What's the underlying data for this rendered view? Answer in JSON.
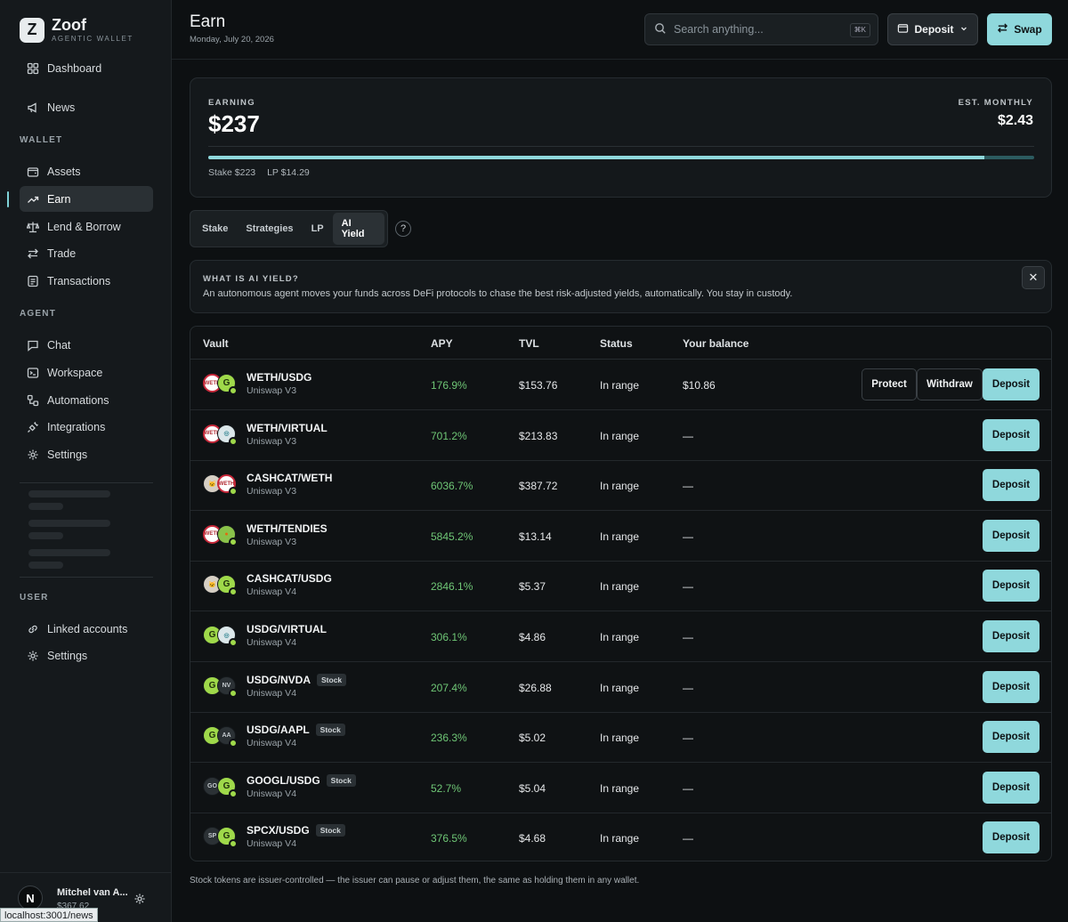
{
  "brand": {
    "name": "Zoof",
    "subtitle": "AGENTIC WALLET",
    "logo_letter": "Z"
  },
  "sidebar": {
    "top_items": [
      {
        "label": "Dashboard",
        "icon": "grid-icon"
      },
      {
        "label": "News",
        "icon": "megaphone-icon"
      }
    ],
    "wallet_label": "WALLET",
    "wallet_items": [
      {
        "label": "Assets",
        "icon": "wallet-icon"
      },
      {
        "label": "Earn",
        "icon": "trending-up-icon",
        "active": true
      },
      {
        "label": "Lend & Borrow",
        "icon": "scale-icon"
      },
      {
        "label": "Trade",
        "icon": "arrows-swap-icon"
      },
      {
        "label": "Transactions",
        "icon": "receipt-icon"
      }
    ],
    "agent_label": "AGENT",
    "agent_items": [
      {
        "label": "Chat",
        "icon": "chat-icon"
      },
      {
        "label": "Workspace",
        "icon": "terminal-icon"
      },
      {
        "label": "Automations",
        "icon": "workflow-icon"
      },
      {
        "label": "Integrations",
        "icon": "plug-icon"
      },
      {
        "label": "Settings",
        "icon": "gear-icon"
      }
    ],
    "user_label": "USER",
    "user_items": [
      {
        "label": "Linked accounts",
        "icon": "link-icon"
      },
      {
        "label": "Settings",
        "icon": "gear-icon"
      }
    ]
  },
  "user": {
    "initial": "N",
    "name": "Mitchel van A...",
    "balance": "$367.62"
  },
  "status_url": "localhost:3001/news",
  "header": {
    "title": "Earn",
    "date": "Monday, July 20, 2026",
    "search_placeholder": "Search anything...",
    "search_shortcut": "⌘K",
    "deposit_label": "Deposit",
    "swap_label": "Swap"
  },
  "summary": {
    "earning_label": "EARNING",
    "earning_value": "$237",
    "monthly_label": "EST. MONTHLY",
    "monthly_value": "$2.43",
    "stake": "Stake $223",
    "lp": "LP $14.29",
    "stake_fraction": 0.94
  },
  "tabs": [
    "Stake",
    "Strategies",
    "LP",
    "AI Yield"
  ],
  "active_tab": "AI Yield",
  "help_glyph": "?",
  "info": {
    "title": "WHAT IS AI YIELD?",
    "text": "An autonomous agent moves your funds across DeFi protocols to chase the best risk-adjusted yields, automatically. You stay in custody.",
    "close_glyph": "✕"
  },
  "table": {
    "headers": {
      "vault": "Vault",
      "apy": "APY",
      "tvl": "TVL",
      "status": "Status",
      "balance": "Your balance"
    },
    "protect_label": "Protect",
    "withdraw_label": "Withdraw",
    "deposit_label": "Deposit",
    "rows": [
      {
        "pair": "WETH/USDG",
        "protocol": "Uniswap V3",
        "apy": "176.9%",
        "tvl": "$153.76",
        "status": "In range",
        "balance": "$10.86",
        "tokens": [
          "weth",
          "usdg"
        ],
        "labels": [
          "WETH",
          "G"
        ],
        "stock": "",
        "actions": true
      },
      {
        "pair": "WETH/VIRTUAL",
        "protocol": "Uniswap V3",
        "apy": "701.2%",
        "tvl": "$213.83",
        "status": "In range",
        "balance": "—",
        "tokens": [
          "weth",
          "virt"
        ],
        "labels": [
          "WETH",
          "◎"
        ],
        "stock": ""
      },
      {
        "pair": "CASHCAT/WETH",
        "protocol": "Uniswap V3",
        "apy": "6036.7%",
        "tvl": "$387.72",
        "status": "In range",
        "balance": "—",
        "tokens": [
          "cat",
          "weth"
        ],
        "labels": [
          "🐱",
          "WETH"
        ],
        "stock": ""
      },
      {
        "pair": "WETH/TENDIES",
        "protocol": "Uniswap V3",
        "apy": "5845.2%",
        "tvl": "$13.14",
        "status": "In range",
        "balance": "—",
        "tokens": [
          "weth",
          "tend"
        ],
        "labels": [
          "WETH",
          "●"
        ],
        "stock": ""
      },
      {
        "pair": "CASHCAT/USDG",
        "protocol": "Uniswap V4",
        "apy": "2846.1%",
        "tvl": "$5.37",
        "status": "In range",
        "balance": "—",
        "tokens": [
          "cat",
          "usdg"
        ],
        "labels": [
          "🐱",
          "G"
        ],
        "stock": ""
      },
      {
        "pair": "USDG/VIRTUAL",
        "protocol": "Uniswap V4",
        "apy": "306.1%",
        "tvl": "$4.86",
        "status": "In range",
        "balance": "—",
        "tokens": [
          "usdg",
          "virt"
        ],
        "labels": [
          "G",
          "◎"
        ],
        "stock": ""
      },
      {
        "pair": "USDG/NVDA",
        "protocol": "Uniswap V4",
        "apy": "207.4%",
        "tvl": "$26.88",
        "status": "In range",
        "balance": "—",
        "tokens": [
          "usdg",
          "plain"
        ],
        "labels": [
          "G",
          "NV"
        ],
        "stock": "Stock"
      },
      {
        "pair": "USDG/AAPL",
        "protocol": "Uniswap V4",
        "apy": "236.3%",
        "tvl": "$5.02",
        "status": "In range",
        "balance": "—",
        "tokens": [
          "usdg",
          "plain"
        ],
        "labels": [
          "G",
          "AA"
        ],
        "stock": "Stock"
      },
      {
        "pair": "GOOGL/USDG",
        "protocol": "Uniswap V4",
        "apy": "52.7%",
        "tvl": "$5.04",
        "status": "In range",
        "balance": "—",
        "tokens": [
          "plain",
          "usdg"
        ],
        "labels": [
          "GO",
          "G"
        ],
        "stock": "Stock"
      },
      {
        "pair": "SPCX/USDG",
        "protocol": "Uniswap V4",
        "apy": "376.5%",
        "tvl": "$4.68",
        "status": "In range",
        "balance": "—",
        "tokens": [
          "plain",
          "usdg"
        ],
        "labels": [
          "SP",
          "G"
        ],
        "stock": "Stock"
      }
    ]
  },
  "footnote": "Stock tokens are issuer-controlled — the issuer can pause or adjust them, the same as holding them in any wallet.",
  "colors": {
    "accent": "#8fd8dc",
    "apy_green": "#6fc776",
    "background": "#0d1012",
    "sidebar": "#15191c"
  }
}
